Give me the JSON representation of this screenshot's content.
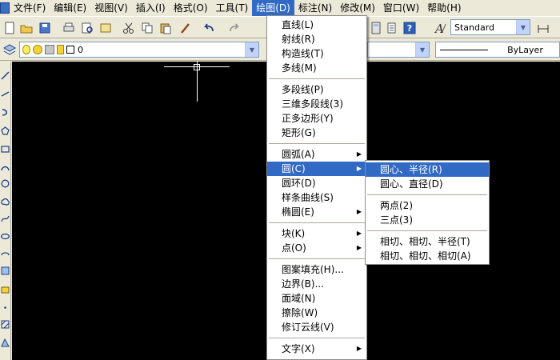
{
  "menubar": {
    "items": [
      "文件(F)",
      "编辑(E)",
      "视图(V)",
      "插入(I)",
      "格式(O)",
      "工具(T)",
      "绘图(D)",
      "标注(N)",
      "修改(M)",
      "窗口(W)",
      "帮助(H)"
    ]
  },
  "toolbar": {
    "text_style": "Standard",
    "layer": "0",
    "linetype": "ByLayer"
  },
  "draw_menu": {
    "items": [
      {
        "label": "直线(L)"
      },
      {
        "label": "射线(R)"
      },
      {
        "label": "构造线(T)"
      },
      {
        "label": "多线(M)"
      },
      {
        "label": "多段线(P)"
      },
      {
        "label": "三维多段线(3)"
      },
      {
        "label": "正多边形(Y)"
      },
      {
        "label": "矩形(G)"
      },
      {
        "label": "圆弧(A)"
      },
      {
        "label": "圆(C)"
      },
      {
        "label": "圆环(D)"
      },
      {
        "label": "样条曲线(S)"
      },
      {
        "label": "椭圆(E)"
      },
      {
        "label": "块(K)"
      },
      {
        "label": "点(O)"
      },
      {
        "label": "图案填充(H)..."
      },
      {
        "label": "边界(B)..."
      },
      {
        "label": "面域(N)"
      },
      {
        "label": "擦除(W)"
      },
      {
        "label": "修订云线(V)"
      },
      {
        "label": "文字(X)"
      }
    ]
  },
  "circle_submenu": {
    "items": [
      {
        "label": "圆心、半径(R)"
      },
      {
        "label": "圆心、直径(D)"
      },
      {
        "label": "两点(2)"
      },
      {
        "label": "三点(3)"
      },
      {
        "label": "相切、相切、半径(T)"
      },
      {
        "label": "相切、相切、相切(A)"
      }
    ]
  },
  "colors": {
    "highlight": "#316ac5",
    "canvas": "#000000",
    "chrome": "#ece9d8"
  }
}
